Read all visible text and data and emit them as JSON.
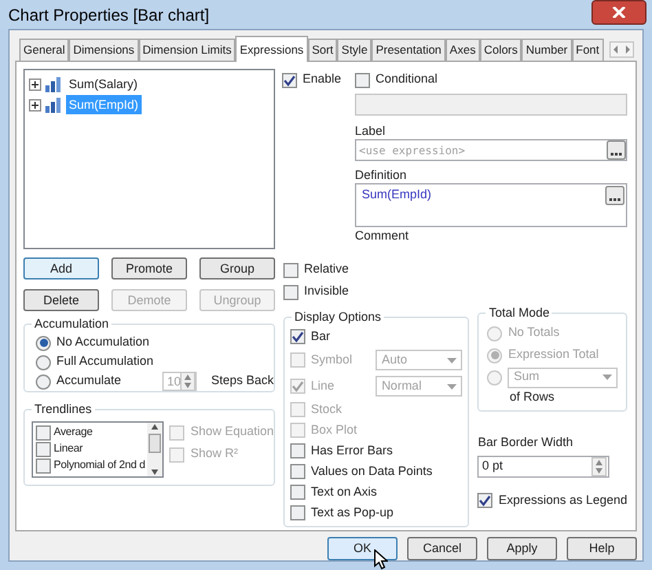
{
  "window": {
    "title": "Chart Properties [Bar chart]"
  },
  "tabs": [
    {
      "label": "General",
      "selected": false
    },
    {
      "label": "Dimensions",
      "selected": false
    },
    {
      "label": "Dimension Limits",
      "selected": false
    },
    {
      "label": "Expressions",
      "selected": true
    },
    {
      "label": "Sort",
      "selected": false
    },
    {
      "label": "Style",
      "selected": false
    },
    {
      "label": "Presentation",
      "selected": false
    },
    {
      "label": "Axes",
      "selected": false
    },
    {
      "label": "Colors",
      "selected": false
    },
    {
      "label": "Number",
      "selected": false
    },
    {
      "label": "Font",
      "selected": false
    }
  ],
  "expressions": [
    {
      "label": "Sum(Salary)",
      "selected": false
    },
    {
      "label": "Sum(EmpId)",
      "selected": true
    }
  ],
  "enable": {
    "label": "Enable",
    "checked": true
  },
  "conditional": {
    "label": "Conditional",
    "checked": false
  },
  "label_field": {
    "label": "Label",
    "placeholder": "<use expression>"
  },
  "definition": {
    "label": "Definition",
    "value": "Sum(EmpId)"
  },
  "comment": {
    "label": "Comment"
  },
  "expression_buttons": [
    {
      "label": "Add",
      "disabled": false,
      "focused": true
    },
    {
      "label": "Promote",
      "disabled": false,
      "focused": false
    },
    {
      "label": "Group",
      "disabled": false,
      "focused": false
    },
    {
      "label": "Delete",
      "disabled": false,
      "focused": false
    },
    {
      "label": "Demote",
      "disabled": true,
      "focused": false
    },
    {
      "label": "Ungroup",
      "disabled": true,
      "focused": false
    }
  ],
  "relative": {
    "label": "Relative",
    "checked": false
  },
  "invisible": {
    "label": "Invisible",
    "checked": false
  },
  "accumulation": {
    "title": "Accumulation",
    "options": [
      {
        "label": "No Accumulation",
        "selected": true
      },
      {
        "label": "Full Accumulation",
        "selected": false
      },
      {
        "label": "Accumulate",
        "selected": false
      }
    ],
    "steps": "10",
    "steps_label": "Steps Back"
  },
  "trendlines": {
    "title": "Trendlines",
    "items": [
      {
        "label": "Average",
        "checked": false
      },
      {
        "label": "Linear",
        "checked": false
      },
      {
        "label": "Polynomial of 2nd d",
        "checked": false
      }
    ],
    "show_equation": {
      "label": "Show Equation",
      "checked": false,
      "disabled": true
    },
    "show_r2": {
      "label": "Show R²",
      "checked": false,
      "disabled": true
    }
  },
  "display_options": {
    "title": "Display Options",
    "items": [
      {
        "label": "Bar",
        "checked": true,
        "disabled": false
      },
      {
        "label": "Symbol",
        "checked": false,
        "disabled": true,
        "select": "Auto"
      },
      {
        "label": "Line",
        "checked": true,
        "disabled": true,
        "select": "Normal"
      },
      {
        "label": "Stock",
        "checked": false,
        "disabled": true
      },
      {
        "label": "Box Plot",
        "checked": false,
        "disabled": true
      },
      {
        "label": "Has Error Bars",
        "checked": false,
        "disabled": false
      },
      {
        "label": "Values on Data Points",
        "checked": false,
        "disabled": false
      },
      {
        "label": "Text on Axis",
        "checked": false,
        "disabled": false
      },
      {
        "label": "Text as Pop-up",
        "checked": false,
        "disabled": false
      }
    ]
  },
  "total_mode": {
    "title": "Total Mode",
    "disabled": true,
    "options": [
      {
        "kind": "text",
        "label": "No Totals",
        "selected": false
      },
      {
        "kind": "text",
        "label": "Expression Total",
        "selected": true
      },
      {
        "kind": "select",
        "label": "Sum",
        "selected": false
      }
    ],
    "suffix": "of Rows"
  },
  "bar_border_width": {
    "label": "Bar Border Width",
    "value": "0 pt"
  },
  "legend": {
    "label": "Expressions as Legend",
    "checked": true
  },
  "buttons": [
    {
      "label": "OK",
      "focused": true
    },
    {
      "label": "Cancel",
      "focused": false
    },
    {
      "label": "Apply",
      "focused": false
    },
    {
      "label": "Help",
      "focused": false
    }
  ]
}
